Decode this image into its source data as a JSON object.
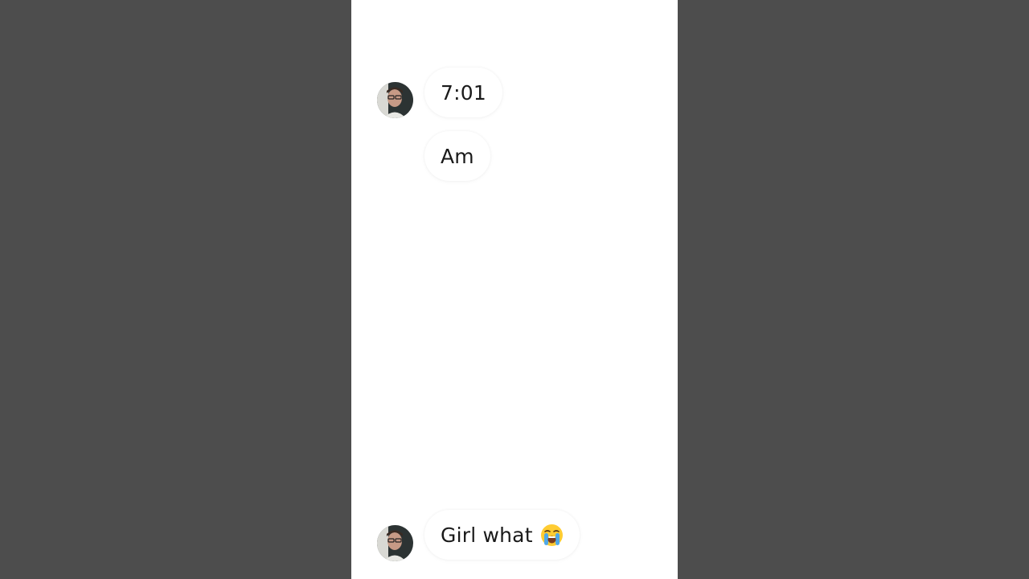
{
  "conversation": {
    "messages": [
      {
        "text": "7:01",
        "sender": "contact"
      },
      {
        "text": "Am",
        "sender": "contact"
      },
      {
        "text": "Girl what",
        "sender": "contact",
        "emoji": "loudly-crying-face-icon"
      }
    ]
  },
  "colors": {
    "background": "#4d4d4d",
    "chat_background": "#ffffff",
    "bubble_text": "#1a1a1a"
  }
}
